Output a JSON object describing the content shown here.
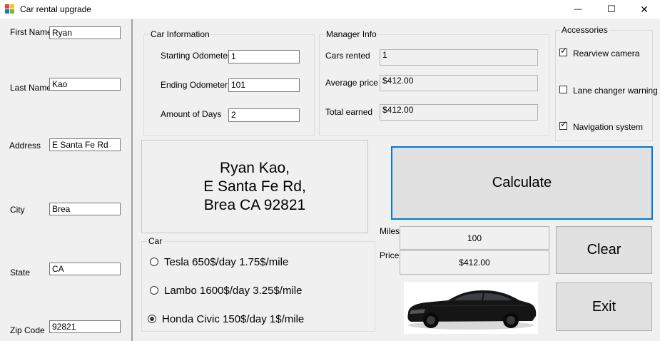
{
  "window": {
    "title": "Car rental upgrade",
    "minimize": "—",
    "maximize": "☐",
    "close": "✕"
  },
  "customer": {
    "first_name_label": "First Name",
    "first_name": "Ryan",
    "last_name_label": "Last Name",
    "last_name": "Kao",
    "address_label": "Address",
    "address": "E Santa Fe Rd",
    "city_label": "City",
    "city": "Brea",
    "state_label": "State",
    "state": "CA",
    "zip_label": "Zip Code",
    "zip": "92821"
  },
  "car_info": {
    "legend": "Car Information",
    "start_odo_label": "Starting Odometer",
    "start_odo": "1",
    "end_odo_label": "Ending Odometer",
    "end_odo": "101",
    "days_label": "Amount of Days",
    "days": "2"
  },
  "manager": {
    "legend": "Manager Info",
    "cars_rented_label": "Cars rented",
    "cars_rented": "1",
    "avg_price_label": "Average price",
    "avg_price": "$412.00",
    "total_label": "Total earned",
    "total": "$412.00"
  },
  "accessories": {
    "legend": "Accessories",
    "items": [
      {
        "label": "Rearview camera",
        "checked": true
      },
      {
        "label": "Lane changer warning",
        "checked": false
      },
      {
        "label": "Navigation system",
        "checked": true
      }
    ]
  },
  "display": {
    "line1": "Ryan Kao,",
    "line2": "E Santa Fe Rd,",
    "line3": "Brea CA 92821"
  },
  "car": {
    "legend": "Car",
    "options": [
      {
        "label": "Tesla 650$/day 1.75$/mile",
        "selected": false
      },
      {
        "label": "Lambo 1600$/day 3.25$/mile",
        "selected": false
      },
      {
        "label": "Honda Civic 150$/day 1$/mile",
        "selected": true
      }
    ]
  },
  "results": {
    "miles_label": "Miles",
    "miles": "100",
    "price_label": "Price",
    "price": "$412.00"
  },
  "buttons": {
    "calculate": "Calculate",
    "clear": "Clear",
    "exit": "Exit"
  },
  "icons": {
    "app": "app-form-icon",
    "car_image": "car-photo"
  }
}
